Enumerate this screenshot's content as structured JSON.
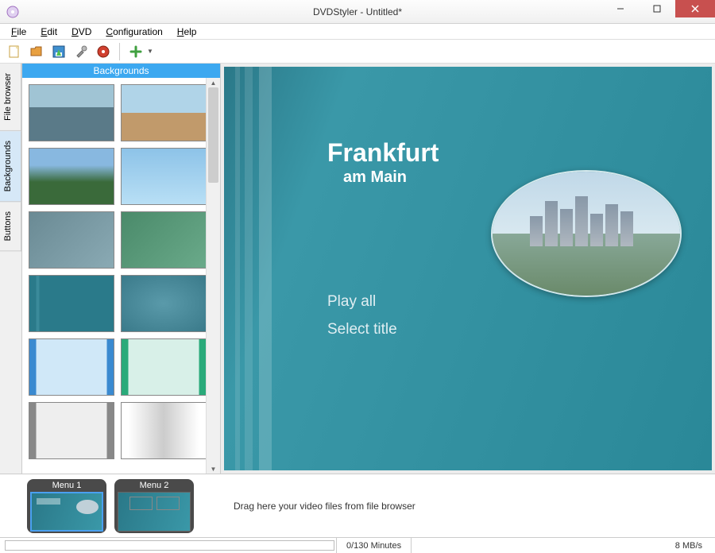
{
  "window": {
    "title": "DVDStyler - Untitled*"
  },
  "menubar": [
    "File",
    "Edit",
    "DVD",
    "Configuration",
    "Help"
  ],
  "toolbar_icons": [
    "new",
    "open",
    "save",
    "settings",
    "burn",
    "add"
  ],
  "vtabs": [
    {
      "label": "File browser",
      "active": false
    },
    {
      "label": "Backgrounds",
      "active": true
    },
    {
      "label": "Buttons",
      "active": false
    }
  ],
  "side_panel": {
    "header": "Backgrounds",
    "thumb_count": 12
  },
  "preview": {
    "title": "Frankfurt",
    "subtitle": "am Main",
    "options": [
      "Play all",
      "Select title"
    ]
  },
  "timeline": {
    "menus": [
      "Menu 1",
      "Menu 2"
    ],
    "hint": "Drag here your video files from file browser"
  },
  "statusbar": {
    "duration": "0/130 Minutes",
    "bitrate": "8 MB/s"
  }
}
